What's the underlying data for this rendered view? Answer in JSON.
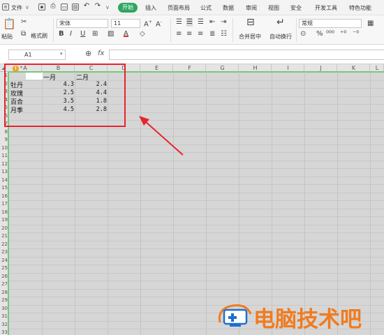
{
  "menubar": {
    "file_label": "文件",
    "tabs": [
      "开始",
      "插入",
      "页面布局",
      "公式",
      "数据",
      "审阅",
      "视图",
      "安全",
      "开发工具",
      "特色功能"
    ]
  },
  "ribbon": {
    "paste_label": "粘贴",
    "format_painter_label": "格式刷",
    "font_name": "宋体",
    "font_size": "11",
    "merge_center_label": "合并居中",
    "wrap_text_label": "自动换行",
    "number_format": "常规",
    "font_color": "#e8232b"
  },
  "formula_bar": {
    "cell_ref": "A1",
    "fx_label": "fx",
    "value": ""
  },
  "sheet": {
    "columns": [
      "A",
      "B",
      "C",
      "D",
      "E",
      "F",
      "G",
      "H",
      "I",
      "J",
      "K",
      "L"
    ],
    "rows": [
      "1",
      "2",
      "3",
      "4",
      "5",
      "6",
      "7",
      "8",
      "9",
      "10",
      "11",
      "12",
      "13",
      "14",
      "15",
      "16",
      "17",
      "18",
      "19",
      "20",
      "21",
      "22",
      "23",
      "24",
      "25",
      "26",
      "27",
      "28",
      "29",
      "30",
      "31",
      "32",
      "33"
    ],
    "header_row": [
      "",
      "一月",
      "二月"
    ],
    "data": [
      [
        "牡丹",
        "4.3",
        "2.4"
      ],
      [
        "玫瑰",
        "2.5",
        "4.4"
      ],
      [
        "百合",
        "3.5",
        "1.8"
      ],
      [
        "月季",
        "4.5",
        "2.8"
      ]
    ]
  },
  "annotation": {
    "highlight_color": "#e8232b"
  },
  "watermark": {
    "text": "电脑技术吧",
    "color": "#f07b20"
  }
}
